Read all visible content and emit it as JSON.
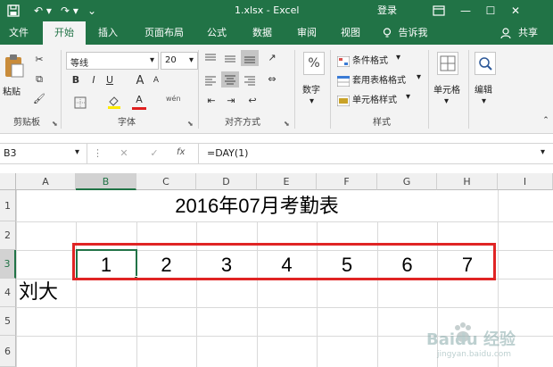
{
  "window": {
    "title": "1.xlsx - Excel",
    "login_label": "登录",
    "accent": "#217346",
    "highlight_box_color": "#e02424",
    "watermark_text": "Baidu 经验",
    "watermark_sub": "jingyan.baidu.com"
  },
  "tabs": [
    {
      "label": "文件"
    },
    {
      "label": "开始"
    },
    {
      "label": "插入"
    },
    {
      "label": "页面布局"
    },
    {
      "label": "公式"
    },
    {
      "label": "数据"
    },
    {
      "label": "审阅"
    },
    {
      "label": "视图"
    },
    {
      "label": "告诉我"
    }
  ],
  "active_tab": "开始",
  "share_label": "共享",
  "ribbon": {
    "clipboard": {
      "paste_label": "粘贴",
      "group_label": "剪贴板"
    },
    "font": {
      "font_name": "等线",
      "font_size": "20",
      "bold": "B",
      "italic": "I",
      "underline": "U",
      "grow_font": "A",
      "shrink_font": "A",
      "font_color": "A",
      "phonetic": "wén",
      "group_label": "字体"
    },
    "alignment": {
      "group_label": "对齐方式"
    },
    "number": {
      "button_label": "数字",
      "percent_symbol": "%"
    },
    "styles": {
      "conditional_format": "条件格式",
      "table_format": "套用表格格式",
      "cell_styles": "单元格样式",
      "group_label": "样式"
    },
    "cells": {
      "button_label": "单元格"
    },
    "editing": {
      "button_label": "编辑"
    }
  },
  "formula_bar": {
    "name_box": "B3",
    "fx": "fx",
    "formula": "=DAY(1)"
  },
  "sheet": {
    "columns": [
      "A",
      "B",
      "C",
      "D",
      "E",
      "F",
      "G",
      "H",
      "I"
    ],
    "rows": [
      "1",
      "2",
      "3",
      "4",
      "5",
      "6"
    ],
    "selected_column": "B",
    "selected_row": "3",
    "title": "2016年07月考勤表",
    "day_numbers": [
      "1",
      "2",
      "3",
      "4",
      "5",
      "6",
      "7"
    ],
    "a4_value": "刘大"
  }
}
